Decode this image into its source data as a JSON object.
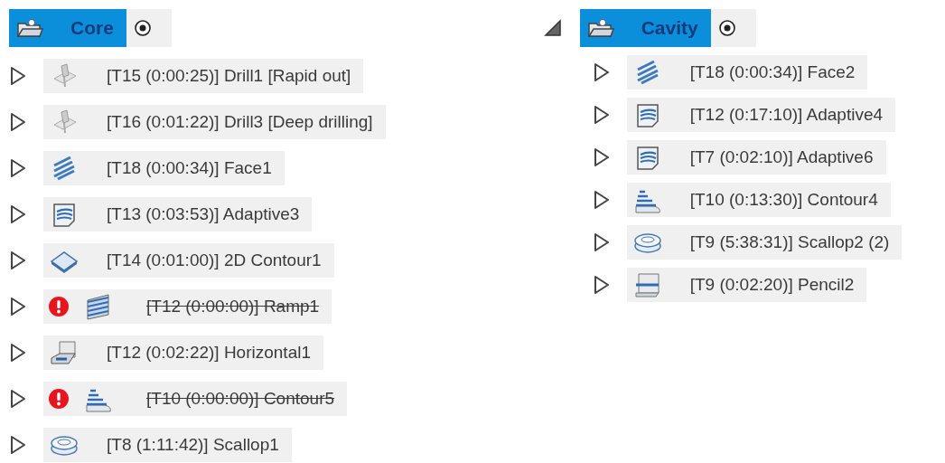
{
  "setups": [
    {
      "name": "Core",
      "selected": true,
      "operations": [
        {
          "kind": "drill",
          "label": "[T15 (0:00:25)] Drill1 [Rapid out]",
          "error": false
        },
        {
          "kind": "drill",
          "label": "[T16 (0:01:22)] Drill3 [Deep drilling]",
          "error": false
        },
        {
          "kind": "face",
          "label": "[T18 (0:00:34)] Face1",
          "error": false
        },
        {
          "kind": "adaptive",
          "label": "[T13 (0:03:53)] Adaptive3",
          "error": false
        },
        {
          "kind": "contour2d",
          "label": "[T14 (0:01:00)] 2D Contour1",
          "error": false
        },
        {
          "kind": "ramp",
          "label": "[T12 (0:00:00)] Ramp1",
          "error": true
        },
        {
          "kind": "horizontal",
          "label": "[T12 (0:02:22)] Horizontal1",
          "error": false
        },
        {
          "kind": "contour",
          "label": "[T10 (0:00:00)] Contour5",
          "error": true
        },
        {
          "kind": "scallop",
          "label": "[T8 (1:11:42)] Scallop1",
          "error": false
        }
      ]
    },
    {
      "name": "Cavity",
      "selected": true,
      "expanded": true,
      "operations": [
        {
          "kind": "face",
          "label": "[T18 (0:00:34)] Face2",
          "error": false
        },
        {
          "kind": "adaptive",
          "label": "[T12 (0:17:10)] Adaptive4",
          "error": false
        },
        {
          "kind": "adaptive",
          "label": "[T7 (0:02:10)] Adaptive6",
          "error": false
        },
        {
          "kind": "contour",
          "label": "[T10 (0:13:30)] Contour4",
          "error": false
        },
        {
          "kind": "scallop",
          "label": "[T9 (5:38:31)] Scallop2 (2)",
          "error": false
        },
        {
          "kind": "pencil",
          "label": "[T9 (0:02:20)] Pencil2",
          "error": false
        }
      ]
    }
  ]
}
